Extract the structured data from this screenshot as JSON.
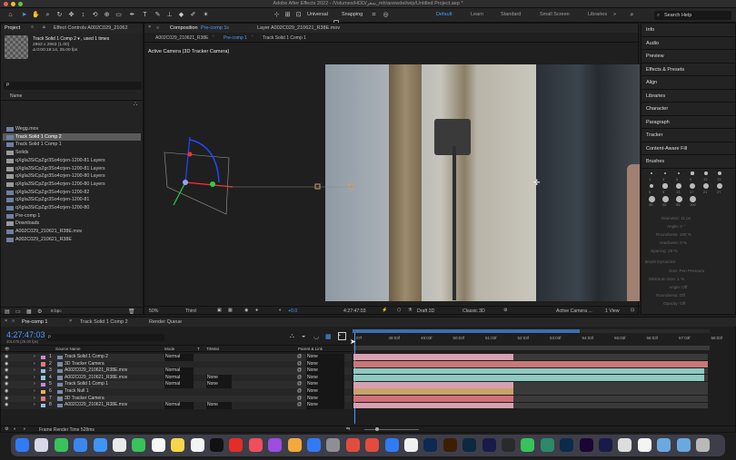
{
  "window": {
    "title": "Adobe After Effects 2022 - /Volumes/HDD/سعر_mh/anewdel/wip/Untitled Project.aep *"
  },
  "toolbar": {
    "universal": "Universal",
    "snapping": "Snapping",
    "workspaces": [
      "Default",
      "Learn",
      "Standard",
      "Small Screen",
      "Libraries"
    ],
    "search_help": "Search Help"
  },
  "project": {
    "tab": "Project",
    "effect_tab": "Effect Controls A002C029_21062",
    "item_title": "Track Solid 1 Comp 2 ▾ , used 1 times",
    "item_dims": "2963 x 2963 (1.00)",
    "item_dur": "Δ 0:00:19:14, 25.00 fps",
    "search_placeholder": "ρ",
    "name_header": "Name",
    "bpc": "8 bpc",
    "items": [
      "Wegg.mov",
      "Track Solid 1 Comp 2",
      "Track Solid 1 Comp 1",
      "Solids",
      "qXgIa3SiCpZgr3So4crjen-1200-81 Layers",
      "qXgIa3SiCpZgr3So4crjen-1200-81 Layers",
      "qXgIa3SiCpZgr3So4crjen-1200-80 Layers",
      "qXgIa3SiCpZgr3So4crjen-1200-80 Layers",
      "qXgIa3SiCpZgr3So4crjen-1200-82",
      "qXgIa3SiCpZgr3So4crjen-1200-81",
      "qXgIa3SiCpZgr3So4crjen-1200-80",
      "Pre-comp 1",
      "Downloads",
      "A002C029_210621_R38E.mov",
      "A002C029_210621_R38E"
    ]
  },
  "composition": {
    "tab_label": "Composition",
    "tab_name": "Pre-comp 1",
    "layer_tab": "Layer A002C029_210621_R38E.mov",
    "crumbs": [
      "A002C029_210621_R38E",
      "Pre-comp 1",
      "Track Solid 1 Comp 1"
    ],
    "active_camera": "Active Camera (3D Tracker Camera)",
    "zoom": "50%",
    "resolution": "Third",
    "exposure": "+0.0",
    "timecode": "4:27:47:03",
    "renderer": "Draft 3D",
    "renderer2": "Classic 3D",
    "view": "Active Camera ...",
    "views": "1 View"
  },
  "right_panels": [
    "Info",
    "Audio",
    "Preview",
    "Effects & Presets",
    "Align",
    "Libraries",
    "Character",
    "Paragraph",
    "Tracker",
    "Content-Aware Fill",
    "Brushes"
  ],
  "brushes": {
    "diameter": "Diameter: 11 px",
    "angle": "Angle: 0 °",
    "roundness": "Roundness: 100 %",
    "hardness": "Hardness: 0 %",
    "spacing": "Spacing: 25 %",
    "dynamics": "Brush Dynamics",
    "size": "Size: Pen Pressure",
    "min_size": "Minimum Size: 1 %",
    "angle2": "Angle: Off",
    "roundness2": "Roundness: Off",
    "opacity": "Opacity: Off",
    "sizes": [
      "1",
      "3",
      "5",
      "9",
      "13",
      "19",
      "5",
      "9",
      "13",
      "17",
      "21",
      "27",
      "35",
      "45",
      "65",
      "100"
    ]
  },
  "timeline": {
    "tabs": [
      "Pre-comp 1",
      "Track Solid 1 Comp 2",
      "Render Queue"
    ],
    "timecode": "4:27:47:03",
    "frames": "401479 (25.00 fps)",
    "headers": {
      "source": "Source Name",
      "mode": "Mode",
      "t": "T",
      "trkmat": "TrkMat",
      "parent": "Parent & Link"
    },
    "ruler": [
      "07f",
      "48:03f",
      "49:03f",
      "50:03f",
      "51:03f",
      "52:03f",
      "53:03f",
      "54:03f",
      "55:03f",
      "56:03f",
      "57:03f",
      "58:03f"
    ],
    "layers": [
      {
        "n": "1",
        "name": "Track Solid 1 Comp 2",
        "mode": "Normal",
        "trk": "",
        "parent": "None",
        "color": "#c98bd6",
        "bar_start": 0.0,
        "bar_end": 0.45,
        "bar_color": "#d7a0b0"
      },
      {
        "n": "2",
        "name": "3D Tracker Camera",
        "mode": "",
        "trk": "",
        "parent": "None",
        "color": "#e07a7a",
        "bar_start": 0.0,
        "bar_end": 1.0,
        "bar_color": "#c87878"
      },
      {
        "n": "3",
        "name": "A002C029_210621_R38E.mov",
        "mode": "Normal",
        "trk": "",
        "parent": "None",
        "color": "#8fc5e0",
        "bar_start": 0.0,
        "bar_end": 0.99,
        "bar_color": "#8ec9c2"
      },
      {
        "n": "4",
        "name": "A002C029_210621_R38E.mov",
        "mode": "Normal",
        "trk": "None",
        "parent": "None",
        "color": "#8fc5e0",
        "bar_start": 0.0,
        "bar_end": 0.99,
        "bar_color": "#8ec9c2"
      },
      {
        "n": "5",
        "name": "Track Solid 1 Comp 1",
        "mode": "Normal",
        "trk": "None",
        "parent": "None",
        "color": "#c98bd6",
        "bar_start": 0.0,
        "bar_end": 0.45,
        "bar_color": "#d7a0b0"
      },
      {
        "n": "6",
        "name": "Track Null 1",
        "mode": "",
        "trk": "",
        "parent": "None",
        "color": "#e8b060",
        "bar_start": 0.0,
        "bar_end": 0.45,
        "bar_color": "#c9a26a"
      },
      {
        "n": "7",
        "name": "3D Tracker Camera",
        "mode": "",
        "trk": "",
        "parent": "None",
        "color": "#e07a7a",
        "bar_start": 0.0,
        "bar_end": 0.45,
        "bar_color": "#cf6f7a"
      },
      {
        "n": "8",
        "name": "A002C029_210621_R38E.mov",
        "mode": "Normal",
        "trk": "None",
        "parent": "None",
        "color": "#8fc5e0",
        "bar_start": 0.0,
        "bar_end": 0.45,
        "bar_color": "#d7a0b0"
      }
    ],
    "render_time": "Frame Render Time 528ms"
  }
}
